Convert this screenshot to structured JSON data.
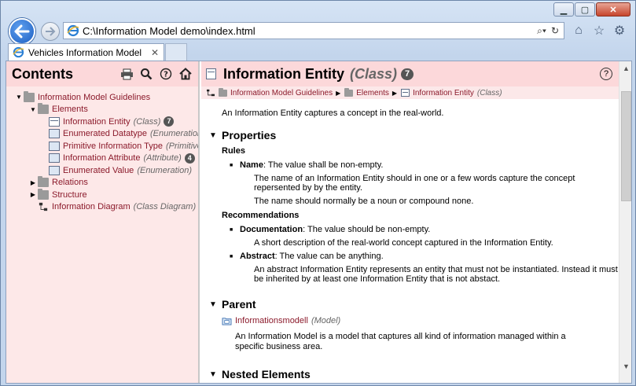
{
  "browser": {
    "url": "C:\\Information Model demo\\index.html",
    "tab_title": "Vehicles Information Model",
    "tab_close": "✕"
  },
  "contents": {
    "title": "Contents",
    "tree": [
      {
        "label": "Information Model Guidelines",
        "meta": "",
        "badge": "",
        "level": 0,
        "toggle": "▼",
        "icon": "folder"
      },
      {
        "label": "Elements",
        "meta": "",
        "badge": "",
        "level": 1,
        "toggle": "▼",
        "icon": "folder"
      },
      {
        "label": "Information Entity",
        "meta": "(Class)",
        "badge": "7",
        "level": 2,
        "toggle": "",
        "icon": "class"
      },
      {
        "label": "Enumerated Datatype",
        "meta": "(Enumeration)",
        "badge": "",
        "level": 2,
        "toggle": "",
        "icon": "datatype"
      },
      {
        "label": "Primitive Information Type",
        "meta": "(Primitive)",
        "badge": "",
        "level": 2,
        "toggle": "",
        "icon": "datatype"
      },
      {
        "label": "Information Attribute",
        "meta": "(Attribute)",
        "badge": "4",
        "level": 2,
        "toggle": "",
        "icon": "datatype"
      },
      {
        "label": "Enumerated Value",
        "meta": "(Enumeration)",
        "badge": "",
        "level": 2,
        "toggle": "",
        "icon": "datatype"
      },
      {
        "label": "Relations",
        "meta": "",
        "badge": "",
        "level": 1,
        "toggle": "▶",
        "icon": "folder"
      },
      {
        "label": "Structure",
        "meta": "",
        "badge": "",
        "level": 1,
        "toggle": "▶",
        "icon": "folder"
      },
      {
        "label": "Information Diagram",
        "meta": "(Class Diagram)",
        "badge": "",
        "level": 1,
        "toggle": "",
        "icon": "diagram"
      }
    ]
  },
  "entity": {
    "title": "Information Entity",
    "type": "(Class)",
    "badge": "7",
    "help": "?",
    "breadcrumb": [
      {
        "label": "Information Model Guidelines",
        "meta": ""
      },
      {
        "label": "Elements",
        "meta": ""
      },
      {
        "label": "Information Entity",
        "meta": "(Class)"
      }
    ],
    "intro": "An Information Entity captures a concept in the real-world."
  },
  "properties": {
    "heading": "Properties",
    "rules_heading": "Rules",
    "name_term": "Name",
    "name_value": ": The value shall be non-empty.",
    "name_desc_1": "The name of an Information Entity should in one or a few words capture the concept repersented by by the entity.",
    "name_desc_2": "The name should normally be a noun or compound none.",
    "rec_heading": "Recommendations",
    "doc_term": "Documentation",
    "doc_value": ": The value should be non-empty.",
    "doc_desc": "A short description of the real-world concept captured in the Information Entity.",
    "abs_term": "Abstract",
    "abs_value": ": The value can be anything.",
    "abs_desc": "An abstract Information Entity represents an entity that must not be instantiated. Instead it must be inherited by at least one Information Entity that is not abstact."
  },
  "parent": {
    "heading": "Parent",
    "name": "Informationsmodell",
    "meta": "(Model)",
    "desc": "An Information Model is a model that captures all kind of information managed within a specific business area."
  },
  "nested": {
    "heading": "Nested Elements"
  },
  "colors": {
    "header_bg": "#fcd8da",
    "pane_bg": "#fde8e8",
    "link": "#8b1a2b"
  }
}
